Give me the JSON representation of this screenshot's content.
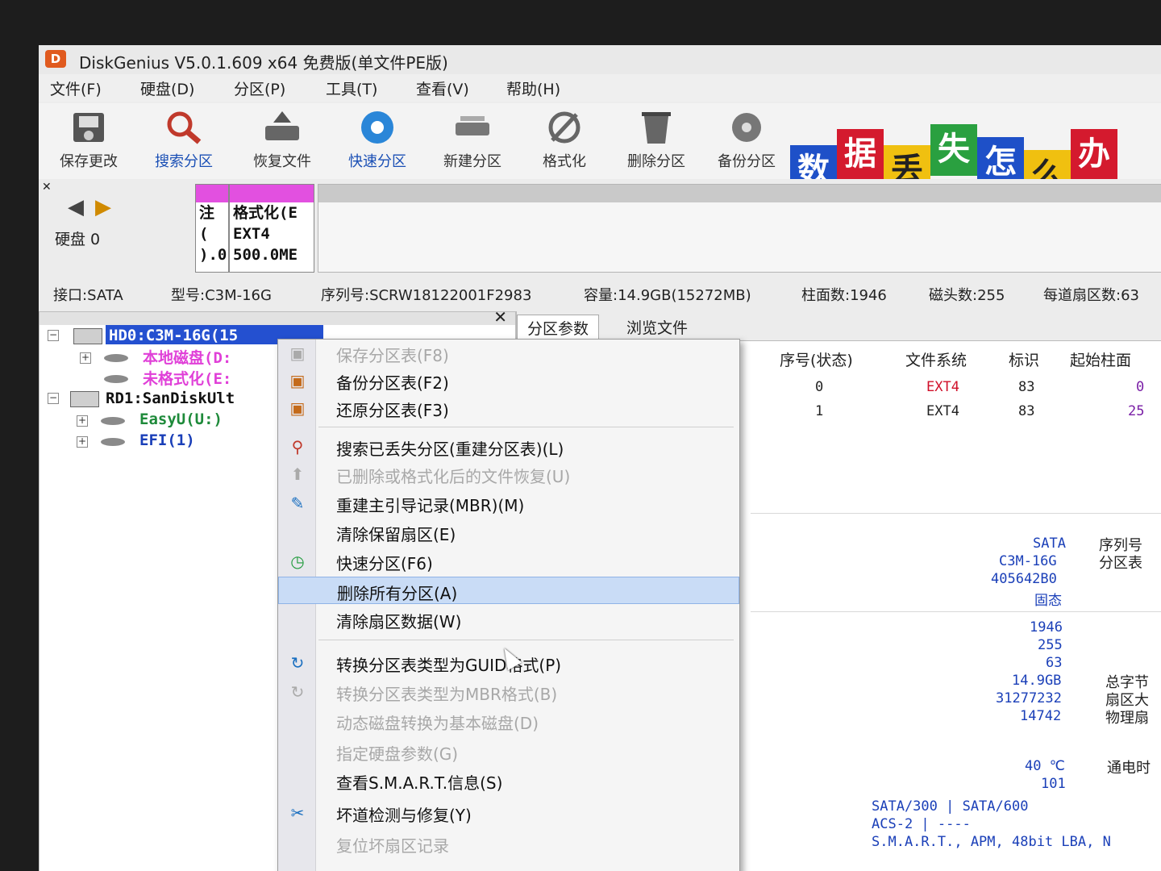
{
  "window": {
    "title": "DiskGenius V5.0.1.609 x64 免费版(单文件PE版)",
    "logo": "D"
  },
  "menubar": [
    "文件(F)",
    "硬盘(D)",
    "分区(P)",
    "工具(T)",
    "查看(V)",
    "帮助(H)"
  ],
  "toolbar": [
    {
      "label": "保存更改",
      "icon": "save-disk-icon"
    },
    {
      "label": "搜索分区",
      "icon": "magnifier-icon"
    },
    {
      "label": "恢复文件",
      "icon": "recover-file-icon"
    },
    {
      "label": "快速分区",
      "icon": "quick-partition-icon"
    },
    {
      "label": "新建分区",
      "icon": "new-partition-icon"
    },
    {
      "label": "格式化",
      "icon": "format-icon"
    },
    {
      "label": "删除分区",
      "icon": "delete-partition-icon"
    },
    {
      "label": "备份分区",
      "icon": "backup-partition-icon"
    }
  ],
  "banner": {
    "chars": [
      "数",
      "据",
      "丢",
      "失",
      "怎",
      "么",
      "办"
    ]
  },
  "diskbar": {
    "disk_label": "硬盘 0",
    "part1_lines": [
      "注",
      "(",
      ").0"
    ],
    "part2_lines": [
      "格式化(E",
      "EXT4",
      "500.0ME"
    ]
  },
  "diskinfo": {
    "interface": "接口:SATA",
    "model": "型号:C3M-16G",
    "serial": "序列号:SCRW18122001F2983",
    "capacity": "容量:14.9GB(15272MB)",
    "cylinders": "柱面数:1946",
    "heads": "磁头数:255",
    "sectors": "每道扇区数:63"
  },
  "tree": {
    "hd0": "HD0:C3M-16G(15",
    "hd0_parts": [
      "本地磁盘(D:",
      "未格式化(E:"
    ],
    "rd1": "RD1:SanDiskUlt",
    "rd1_parts": [
      "EasyU(U:)",
      "EFI(1)"
    ]
  },
  "tabs": [
    "分区参数",
    "浏览文件"
  ],
  "table": {
    "headers": [
      "序号(状态)",
      "文件系统",
      "标识",
      "起始柱面"
    ],
    "rows": [
      {
        "idx": "0",
        "fs": "EXT4",
        "id": "83",
        "start": "0"
      },
      {
        "idx": "1",
        "fs": "EXT4",
        "id": "83",
        "start": "25"
      }
    ]
  },
  "details": {
    "values1": [
      "SATA",
      "C3M-16G",
      "405642B0",
      "固态"
    ],
    "labels1": [
      "序列号",
      "分区表"
    ],
    "values2": [
      "1946",
      "255",
      "63",
      "14.9GB",
      "31277232",
      "14742"
    ],
    "labels2": [
      "总字节",
      "扇区大",
      "物理扇"
    ],
    "temp": "40 ℃",
    "temp_label": "通电时",
    "val101": "101",
    "bottom": [
      "SATA/300 | SATA/600",
      "ACS-2 | ----",
      "S.M.A.R.T., APM, 48bit LBA, N"
    ]
  },
  "context_menu": [
    {
      "label": "保存分区表(F8)",
      "disabled": true,
      "icon": "save-table-icon"
    },
    {
      "label": "备份分区表(F2)",
      "disabled": false,
      "icon": "backup-table-icon"
    },
    {
      "label": "还原分区表(F3)",
      "disabled": false,
      "icon": "restore-table-icon"
    },
    {
      "label": "搜索已丢失分区(重建分区表)(L)",
      "disabled": false,
      "icon": "search-lost-icon"
    },
    {
      "label": "已删除或格式化后的文件恢复(U)",
      "disabled": true,
      "icon": "file-recover-icon"
    },
    {
      "label": "重建主引导记录(MBR)(M)",
      "disabled": false,
      "icon": "rebuild-mbr-icon"
    },
    {
      "label": "清除保留扇区(E)",
      "disabled": false,
      "icon": ""
    },
    {
      "label": "快速分区(F6)",
      "disabled": false,
      "icon": "quick-partition-icon"
    },
    {
      "label": "删除所有分区(A)",
      "disabled": false,
      "icon": "",
      "highlight": true
    },
    {
      "label": "清除扇区数据(W)",
      "disabled": false,
      "icon": ""
    },
    {
      "label": "转换分区表类型为GUID格式(P)",
      "disabled": false,
      "icon": "convert-guid-icon"
    },
    {
      "label": "转换分区表类型为MBR格式(B)",
      "disabled": true,
      "icon": "convert-mbr-icon"
    },
    {
      "label": "动态磁盘转换为基本磁盘(D)",
      "disabled": true,
      "icon": ""
    },
    {
      "label": "指定硬盘参数(G)",
      "disabled": true,
      "icon": ""
    },
    {
      "label": "查看S.M.A.R.T.信息(S)",
      "disabled": false,
      "icon": ""
    },
    {
      "label": "坏道检测与修复(Y)",
      "disabled": false,
      "icon": "bad-sector-tool-icon"
    },
    {
      "label": "复位坏扇区记录",
      "disabled": true,
      "icon": ""
    }
  ],
  "colors": {
    "accent": "#2450d0",
    "highlight": "#c9dcf6",
    "partition": "#e250e0",
    "fs_red": "#d0102a"
  }
}
